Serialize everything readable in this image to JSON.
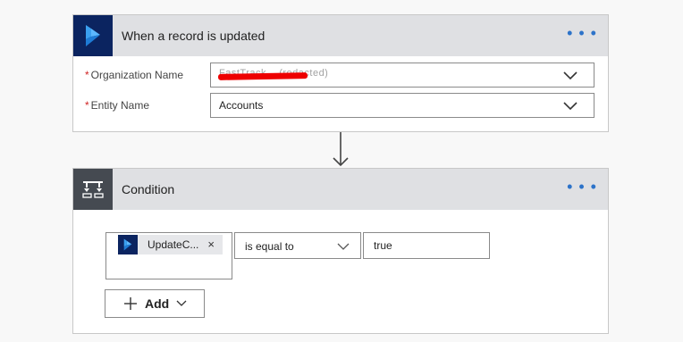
{
  "trigger": {
    "title": "When a record is updated",
    "app_icon": "dynamics-icon",
    "more_label": "• • •",
    "fields": [
      {
        "required_mark": "*",
        "label": "Organization Name",
        "value": "FastTrack... (redacted)"
      },
      {
        "required_mark": "*",
        "label": "Entity Name",
        "value": "Accounts"
      }
    ]
  },
  "condition": {
    "title": "Condition",
    "app_icon": "condition-icon",
    "more_label": "• • •",
    "operand_token": {
      "text": "UpdateC...",
      "close": "×",
      "icon": "dynamics-icon"
    },
    "operator": "is equal to",
    "value": "true",
    "add_label": "Add"
  },
  "colors": {
    "dynamics_blue": "#0b2460",
    "condition_gray": "#454a51",
    "accent": "#2d73c9",
    "required": "#d02323"
  }
}
